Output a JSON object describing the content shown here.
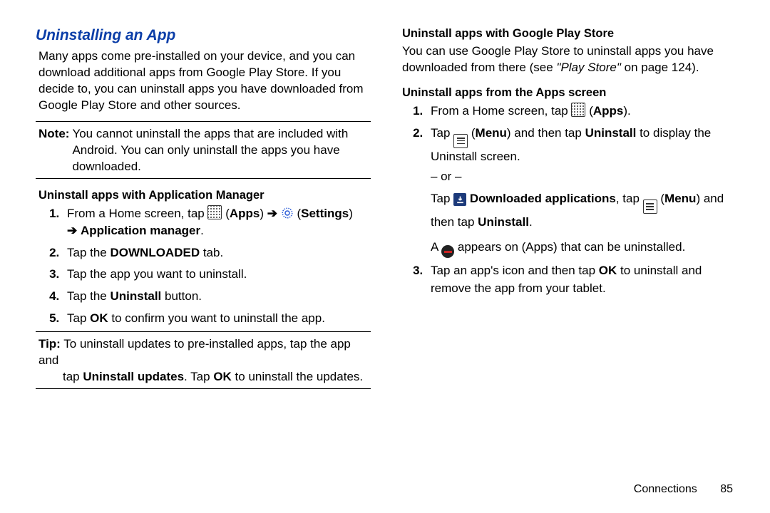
{
  "left": {
    "heading": "Uninstalling an App",
    "intro": "Many apps come pre-installed on your device, and you can download additional apps from Google Play Store. If you decide to, you can uninstall apps you have downloaded from Google Play Store and other sources.",
    "note_label": "Note:",
    "note_body": "You cannot uninstall the apps that are included with Android. You can only uninstall the apps you have downloaded.",
    "sub1": "Uninstall apps with Application Manager",
    "step1_a": "From a Home screen, tap ",
    "step1_apps": "Apps",
    "step1_b": ") ",
    "step1_settings": "Settings",
    "step1_c": " Application manager",
    "step2_a": "Tap the ",
    "step2_b": "DOWNLOADED",
    "step2_c": " tab.",
    "step3": "Tap the app you want to uninstall.",
    "step4_a": "Tap the ",
    "step4_b": "Uninstall",
    "step4_c": " button.",
    "step5_a": "Tap ",
    "step5_b": "OK",
    "step5_c": " to confirm you want to uninstall the app.",
    "tip_label": "Tip:",
    "tip1": " To uninstall updates to pre-installed apps, tap the app and ",
    "tip2a": "tap ",
    "tip2b": "Uninstall updates",
    "tip2c": ". Tap ",
    "tip2d": "OK",
    "tip2e": " to uninstall the updates."
  },
  "right": {
    "sub2": "Uninstall apps with Google Play Store",
    "para2a": "You can use Google Play Store to uninstall apps you have downloaded from there (see ",
    "para2b": "\"Play Store\"",
    "para2c": " on page 124).",
    "sub3": "Uninstall apps from the Apps screen",
    "r1_a": "From a Home screen, tap ",
    "r1_apps": "Apps",
    "r2_a": "Tap ",
    "r2_menu": "Menu",
    "r2_b": ") and then tap ",
    "r2_c": "Uninstall",
    "r2_d": " to display the Uninstall screen.",
    "or": "– or –",
    "r2_e": "Tap ",
    "r2_f": "Downloaded applications",
    "r2_g": ", tap ",
    "r2_h": "Menu",
    "r2_i": ") and then tap ",
    "r2_j": "Uninstall",
    "r2_k": "A ",
    "r2_l": " appears on (Apps) that can be uninstalled.",
    "r3_a": "Tap an app's icon and then tap ",
    "r3_b": "OK",
    "r3_c": " to uninstall and remove the app from your tablet."
  },
  "footer": {
    "section": "Connections",
    "page": "85"
  },
  "arrows": {
    "right": "➔"
  }
}
